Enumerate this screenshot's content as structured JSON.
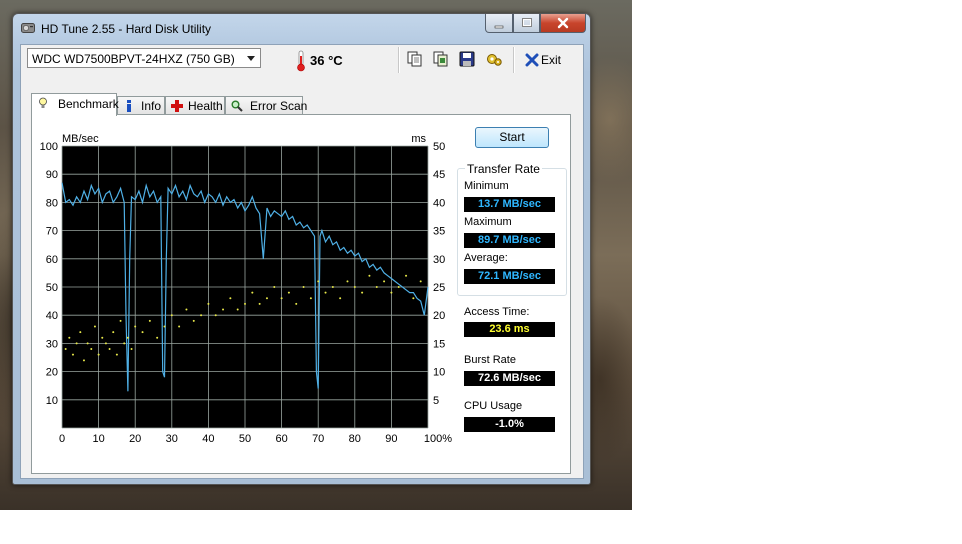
{
  "window": {
    "title": "HD Tune 2.55 - Hard Disk Utility"
  },
  "toolbar": {
    "drive": "WDC WD7500BPVT-24HXZ (750 GB)",
    "temperature": "36 °C",
    "exit_label": "Exit",
    "icons": [
      "copy-text-icon",
      "copy-screenshot-icon",
      "save-icon",
      "options-icon",
      "exit-icon"
    ]
  },
  "tabs": [
    {
      "label": "Benchmark",
      "active": true
    },
    {
      "label": "Info",
      "active": false
    },
    {
      "label": "Health",
      "active": false
    },
    {
      "label": "Error Scan",
      "active": false
    }
  ],
  "benchmark": {
    "start_label": "Start",
    "transfer_rate": {
      "title": "Transfer Rate",
      "minimum_label": "Minimum",
      "minimum": "13.7 MB/sec",
      "maximum_label": "Maximum",
      "maximum": "89.7 MB/sec",
      "average_label": "Average:",
      "average": "72.1 MB/sec"
    },
    "access_time_label": "Access Time:",
    "access_time": "23.6 ms",
    "burst_rate_label": "Burst Rate",
    "burst_rate": "72.6 MB/sec",
    "cpu_usage_label": "CPU Usage",
    "cpu_usage": "-1.0%"
  },
  "chart_data": {
    "type": "line",
    "ylabel_left": "MB/sec",
    "ylabel_right": "ms",
    "ylim_left": [
      0,
      100
    ],
    "ylim_right": [
      0,
      50
    ],
    "xlim": [
      0,
      100
    ],
    "x_ticks": [
      "0",
      "10",
      "20",
      "30",
      "40",
      "50",
      "60",
      "70",
      "80",
      "90",
      "100%"
    ],
    "y_ticks_left": [
      "100",
      "90",
      "80",
      "70",
      "60",
      "50",
      "40",
      "30",
      "20",
      "10"
    ],
    "y_ticks_right": [
      "50",
      "45",
      "40",
      "35",
      "30",
      "25",
      "20",
      "15",
      "10",
      "5"
    ],
    "grid": true,
    "background": "#000000",
    "grid_color": "#9aa6a0",
    "series": [
      {
        "name": "Transfer Rate",
        "color": "#4fb0e6",
        "x": [
          0,
          1,
          2,
          3,
          4,
          5,
          6,
          7,
          8,
          9,
          10,
          11,
          12,
          13,
          14,
          15,
          16,
          17,
          17.5,
          18,
          18.5,
          19,
          20,
          21,
          22,
          23,
          24,
          25,
          26,
          27,
          27.5,
          28,
          28.5,
          29,
          30,
          31,
          32,
          33,
          34,
          35,
          36,
          37,
          38,
          39,
          40,
          41,
          42,
          43,
          44,
          45,
          46,
          47,
          48,
          49,
          50,
          51,
          52,
          53,
          54,
          55,
          56,
          57,
          58,
          59,
          60,
          61,
          62,
          63,
          64,
          65,
          66,
          67,
          68,
          69,
          69.5,
          70,
          70.5,
          71,
          72,
          73,
          74,
          75,
          76,
          77,
          78,
          79,
          80,
          81,
          82,
          83,
          84,
          85,
          86,
          87,
          88,
          89,
          90,
          91,
          92,
          93,
          94,
          95,
          96,
          97,
          98,
          99,
          100
        ],
        "y": [
          87,
          80,
          81,
          79,
          82,
          80,
          84,
          81,
          86,
          83,
          85,
          80,
          83,
          84,
          80,
          82,
          85,
          80,
          40,
          13,
          60,
          82,
          81,
          84,
          80,
          86,
          82,
          84,
          80,
          82,
          20,
          18,
          60,
          85,
          83,
          86,
          82,
          84,
          81,
          86,
          83,
          82,
          84,
          80,
          83,
          82,
          80,
          83,
          79,
          82,
          80,
          81,
          78,
          80,
          77,
          79,
          82,
          78,
          76,
          60,
          78,
          75,
          77,
          76,
          75,
          77,
          74,
          75,
          72,
          73,
          71,
          72,
          70,
          68,
          20,
          14,
          68,
          70,
          66,
          68,
          65,
          66,
          63,
          64,
          62,
          63,
          61,
          62,
          59,
          60,
          57,
          58,
          56,
          57,
          55,
          54,
          53,
          52,
          51,
          50,
          49,
          48,
          48,
          46,
          45,
          40,
          50
        ]
      },
      {
        "name": "Access Time",
        "color": "#e8e84a",
        "note_type": "scatter",
        "x": [
          1,
          2,
          3,
          4,
          5,
          6,
          7,
          8,
          9,
          10,
          11,
          12,
          13,
          14,
          15,
          16,
          17,
          18,
          19,
          20,
          22,
          24,
          26,
          28,
          30,
          32,
          34,
          36,
          38,
          40,
          42,
          44,
          46,
          48,
          50,
          52,
          54,
          56,
          58,
          60,
          62,
          64,
          66,
          68,
          70,
          72,
          74,
          76,
          78,
          80,
          82,
          84,
          86,
          88,
          90,
          92,
          94,
          96,
          98
        ],
        "y": [
          14,
          16,
          13,
          15,
          17,
          12,
          15,
          14,
          18,
          13,
          16,
          15,
          14,
          17,
          13,
          19,
          15,
          16,
          14,
          18,
          17,
          19,
          16,
          18,
          20,
          18,
          21,
          19,
          20,
          22,
          20,
          21,
          23,
          21,
          22,
          24,
          22,
          23,
          25,
          23,
          24,
          22,
          25,
          23,
          26,
          24,
          25,
          23,
          26,
          25,
          24,
          27,
          25,
          26,
          24,
          25,
          27,
          23,
          26
        ]
      }
    ]
  }
}
